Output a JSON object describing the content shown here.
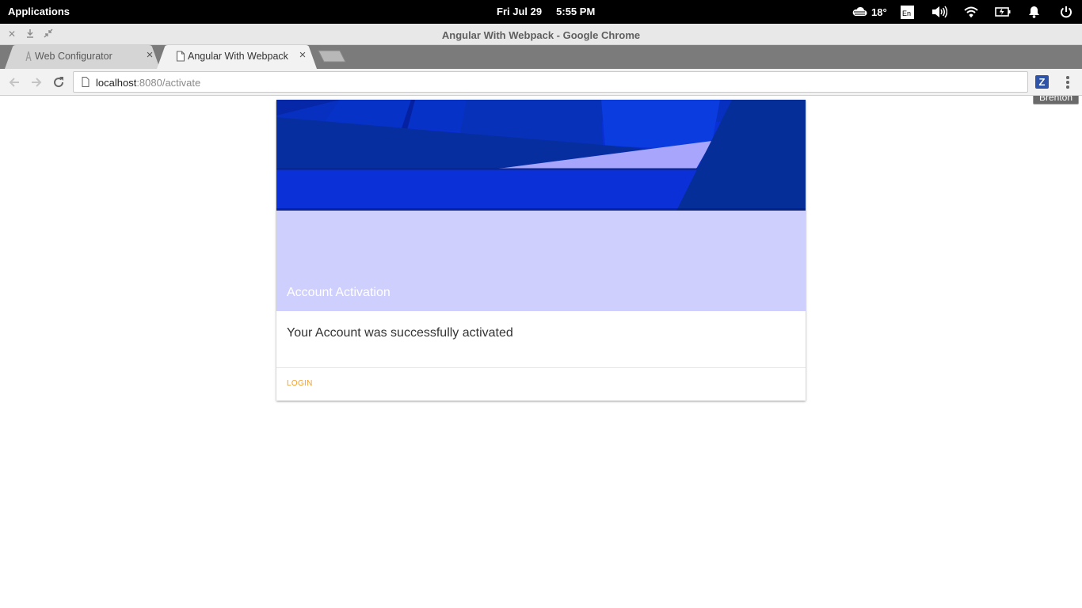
{
  "system_bar": {
    "applications_label": "Applications",
    "clock": "Fri Jul 29     5:55 PM",
    "weather_temp": "18°",
    "keyboard_layout": "En"
  },
  "window": {
    "title": "Angular With Webpack - Google Chrome"
  },
  "tabs": [
    {
      "title": "Web Configurator",
      "icon": "generic-site-icon",
      "active": false
    },
    {
      "title": "Angular With Webpack",
      "icon": "page-icon",
      "active": true
    }
  ],
  "profile_name": "Brenton",
  "address_bar": {
    "host": "localhost",
    "path": ":8080/activate"
  },
  "extension_label": "Z",
  "card": {
    "title": "Account Activation",
    "message": "Your Account was successfully activated",
    "action_label": "LOGIN",
    "colors": {
      "title_background": "#cfcffe",
      "hero_blue": "#0a2fd6",
      "hero_dark": "#062fa0",
      "action": "#f0a030"
    }
  }
}
